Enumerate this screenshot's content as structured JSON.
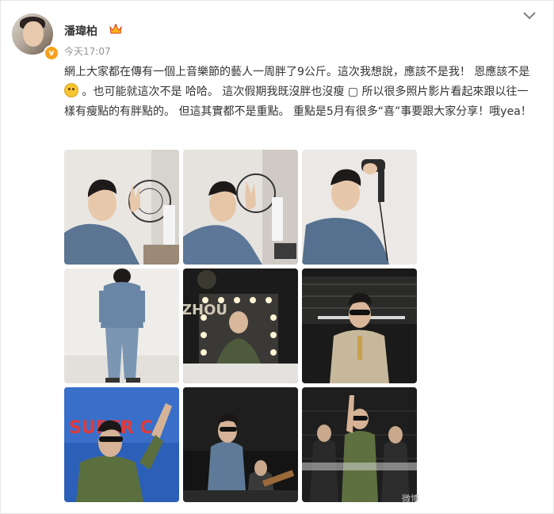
{
  "user": {
    "name": "潘瑋柏",
    "time": "今天17:07",
    "badge_icon": "crown-icon",
    "verify_icon": "verified-v-icon"
  },
  "post": {
    "text_before_emoji": "網上大家都在傳有一個上音樂節的藝人一周胖了9公斤。這次我想說，應該不是我！ 恩應該不是",
    "emoji_icon": "smile-emoji-icon",
    "text_after_emoji": " 。也可能就這次不是 哈哈。 這次假期我既沒胖也沒瘦 ▢ 所以很多照片影片看起來跟以往一樣有瘦點的有胖點的。 但這其實都不是重點。 重點是5月有很多“喜”事要跟大家分享！哦yea！"
  },
  "photos": [
    {
      "name": "photo-1",
      "subject": "peace sign with desk fan"
    },
    {
      "name": "photo-2",
      "subject": "peace sign in denim jacket"
    },
    {
      "name": "photo-3",
      "subject": "holding hair dryer"
    },
    {
      "name": "photo-4",
      "subject": "back view in denim outfit"
    },
    {
      "name": "photo-5",
      "subject": "mirror with vanity lights"
    },
    {
      "name": "photo-6",
      "subject": "stage in beige bomber"
    },
    {
      "name": "photo-7",
      "subject": "pointing up on stage"
    },
    {
      "name": "photo-8",
      "subject": "singing with guitarist"
    },
    {
      "name": "photo-9",
      "subject": "rock hand with band"
    }
  ],
  "photo_overlays": {
    "mirror_text": "ZHOU",
    "screen_text": "SUPER C"
  },
  "watermark": "微博"
}
